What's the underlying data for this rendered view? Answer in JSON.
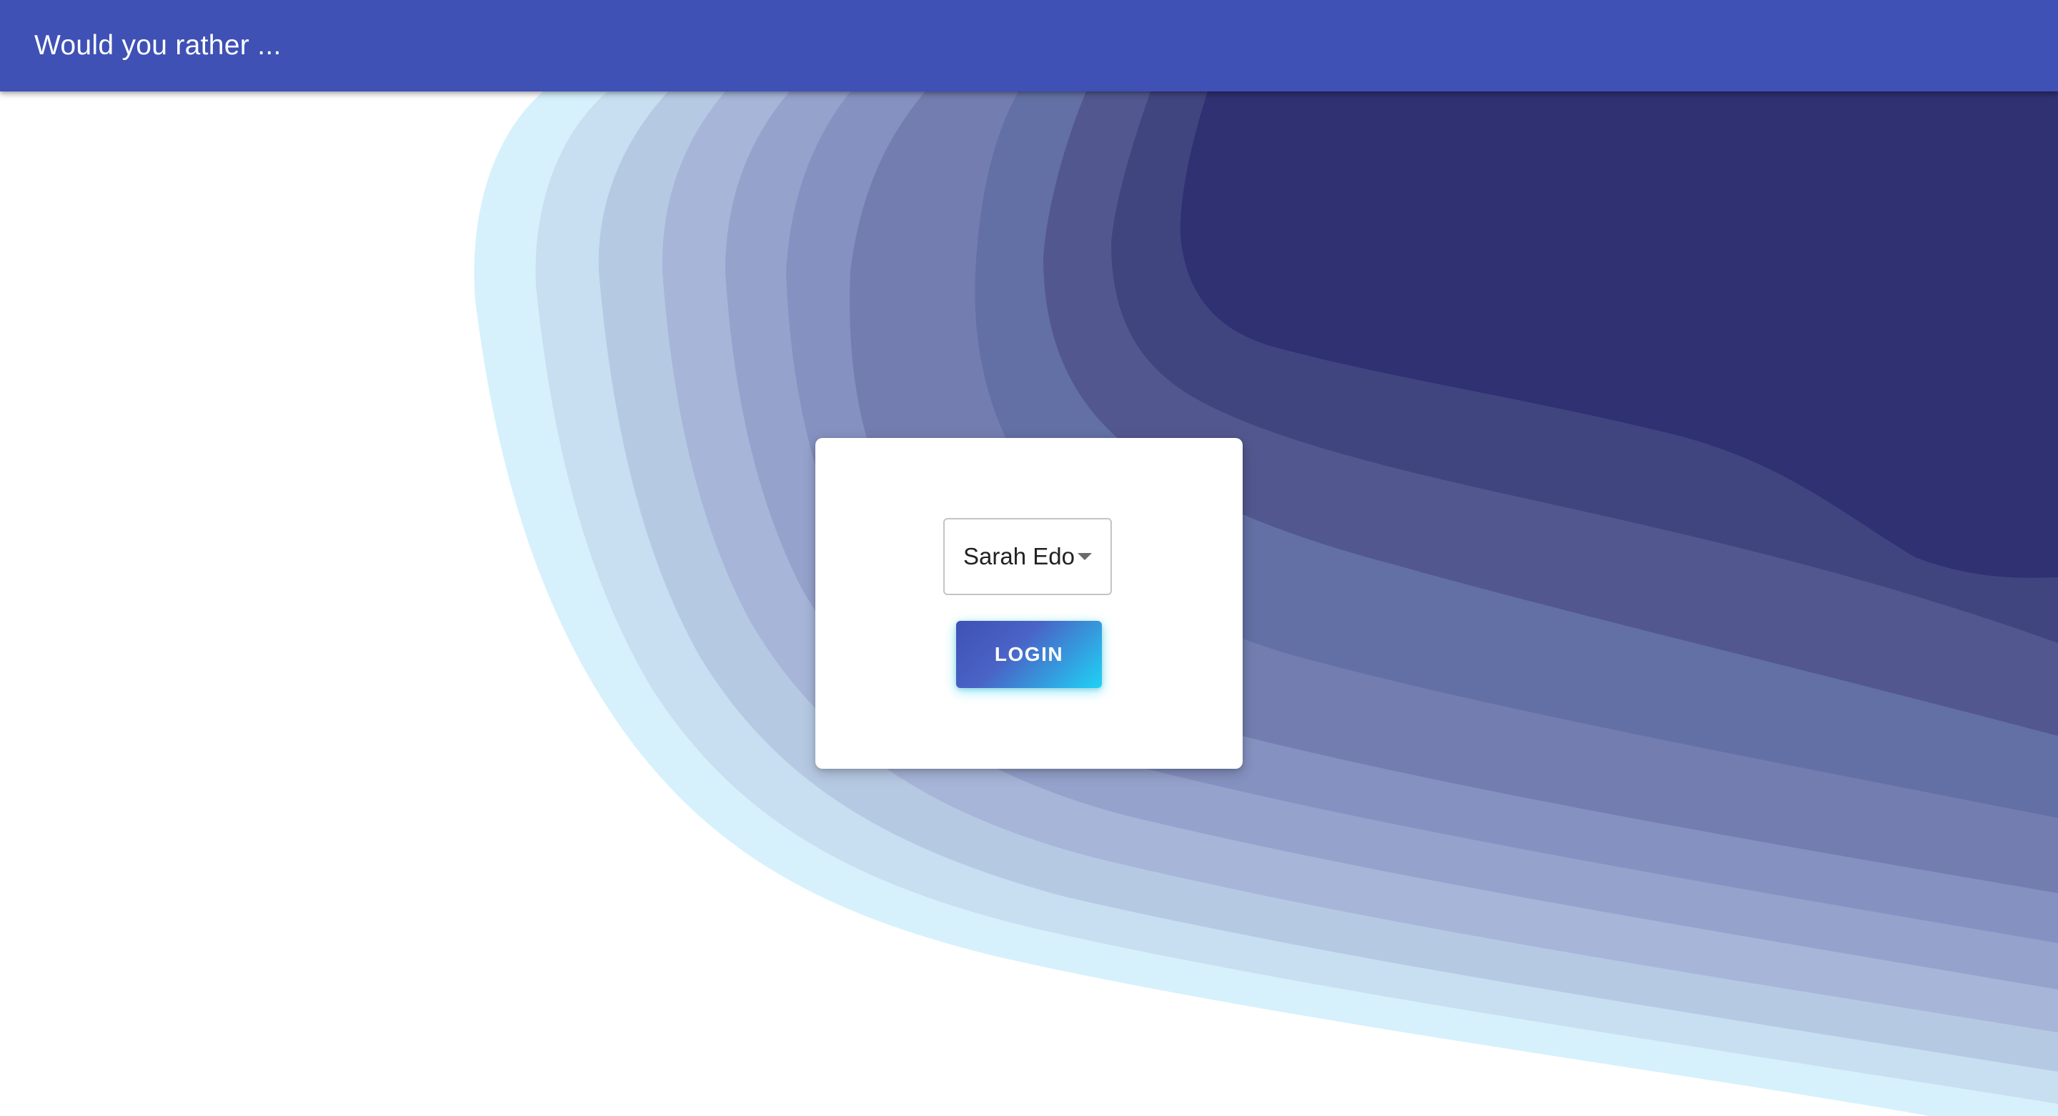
{
  "app_bar": {
    "title": "Would you rather ..."
  },
  "login": {
    "selected_user": "Sarah Edo",
    "button_label": "LOGIN"
  },
  "colors": {
    "app_bar": "#3f51b5",
    "wave_layers": [
      "#d6f1fc",
      "#c7dff0",
      "#b6c9e3",
      "#a6b5d8",
      "#95a2cc",
      "#8591c0",
      "#737db0",
      "#6370a5",
      "#52588f",
      "#41457f",
      "#2f3173"
    ]
  }
}
